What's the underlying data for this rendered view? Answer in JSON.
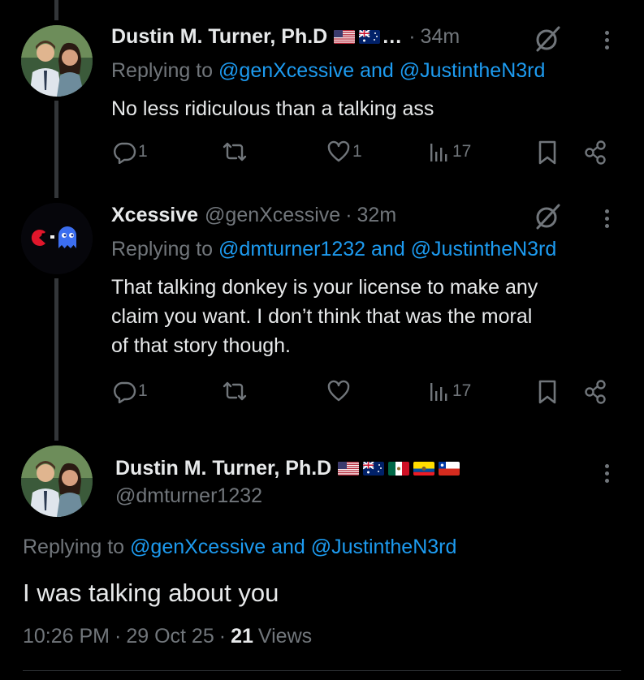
{
  "tweets": [
    {
      "display_name": "Dustin M. Turner, Ph.D",
      "ellipsis": "…",
      "separator": "·",
      "time": "34m",
      "reply_prefix": "Replying to",
      "reply_handles": "@genXcessive and @JustintheN3rd",
      "text": "No less ridiculous than a talking ass",
      "replies": "1",
      "likes": "1",
      "views": "17"
    },
    {
      "display_name": "Xcessive",
      "handle": "@genXcessive",
      "separator": "·",
      "time": "32m",
      "reply_prefix": "Replying to",
      "reply_handles": "@dmturner1232 and @JustintheN3rd",
      "text_lines": [
        "That talking donkey is your license to make any",
        "claim you want.  I don’t think that was the moral",
        "of that story though."
      ],
      "replies": "1",
      "views": "17"
    }
  ],
  "main_tweet": {
    "display_name": "Dustin M. Turner, Ph.D",
    "handle": "@dmturner1232",
    "reply_prefix": "Replying to",
    "reply_handles": "@genXcessive and @JustintheN3rd",
    "text": "I was talking about you",
    "time": "10:26 PM",
    "date": "29 Oct 25",
    "separator": "·",
    "views_count": "21",
    "views_label": "Views"
  },
  "colors": {
    "background": "#000000",
    "text": "#e7e9ea",
    "muted": "#71767b",
    "link": "#1d9bf0",
    "thread_line": "#333639"
  },
  "icons": [
    "reply-icon",
    "retweet-icon",
    "like-icon",
    "views-icon",
    "bookmark-icon",
    "share-icon",
    "grok-icon",
    "more-icon"
  ]
}
